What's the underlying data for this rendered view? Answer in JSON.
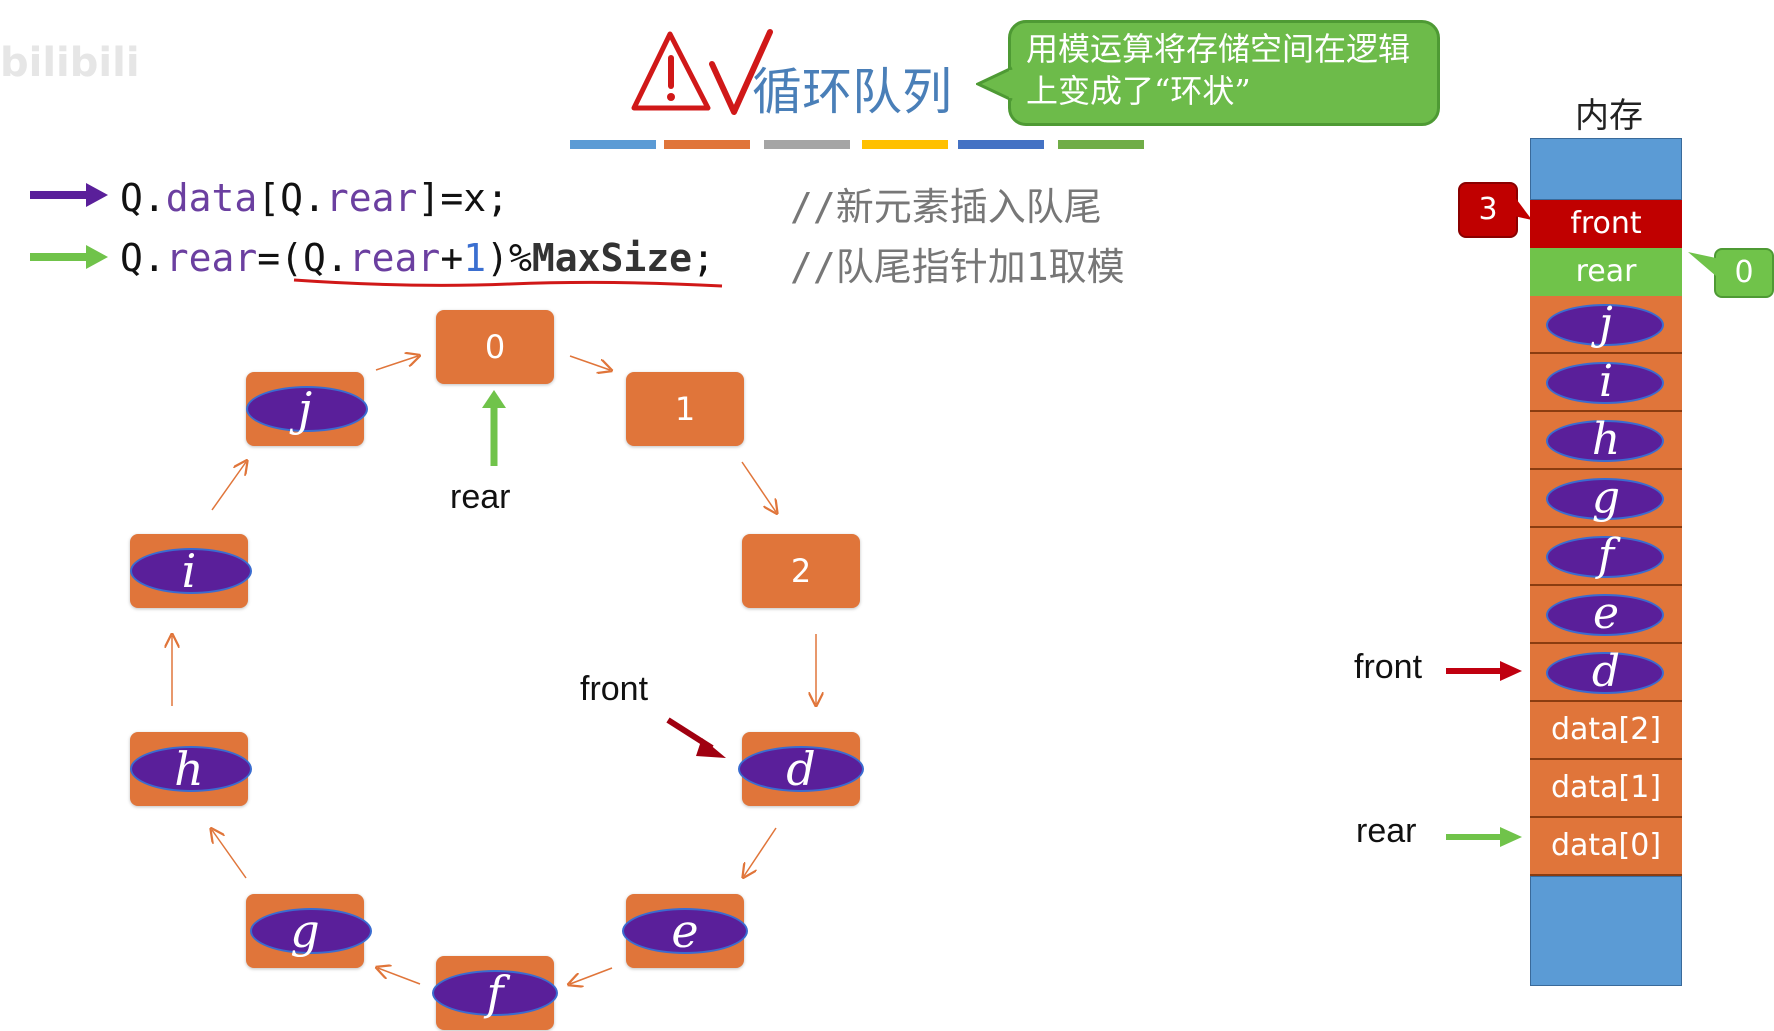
{
  "watermark": "bilibili",
  "header": {
    "title": "循环队列",
    "bubble_text": "用模运算将存储空间在逻辑上变成了“环状”"
  },
  "code": {
    "line1": {
      "parts": [
        "Q.",
        "data",
        "[Q.",
        "rear",
        "]=x;"
      ],
      "comment": "//新元素插入队尾"
    },
    "line2": {
      "parts": [
        "Q.",
        "rear",
        "=(Q.",
        "rear",
        "+",
        "1",
        ")%",
        "MaxSize",
        ";"
      ],
      "comment": "//队尾指针加1取模"
    }
  },
  "ring": {
    "slots": [
      {
        "label": "0",
        "element": ""
      },
      {
        "label": "1",
        "element": ""
      },
      {
        "label": "2",
        "element": ""
      },
      {
        "label": "",
        "element": "d"
      },
      {
        "label": "",
        "element": "e"
      },
      {
        "label": "",
        "element": "f"
      },
      {
        "label": "",
        "element": "g"
      },
      {
        "label": "",
        "element": "h"
      },
      {
        "label": "",
        "element": "i"
      },
      {
        "label": "",
        "element": "j"
      }
    ],
    "rear_label": "rear",
    "front_label": "front"
  },
  "memory": {
    "title": "内存",
    "front_field": "front",
    "rear_field": "rear",
    "front_value": "3",
    "rear_value": "0",
    "elements": [
      "j",
      "i",
      "h",
      "g",
      "f",
      "e",
      "d"
    ],
    "data_cells": [
      "data[2]",
      "data[1]",
      "data[0]"
    ],
    "front_pointer_label": "front",
    "rear_pointer_label": "rear"
  },
  "colors": {
    "box": "#e0753a",
    "element": "#5a1f9a",
    "front": "#c00000",
    "rear": "#70c34a",
    "memory_blue": "#5b9bd5"
  }
}
